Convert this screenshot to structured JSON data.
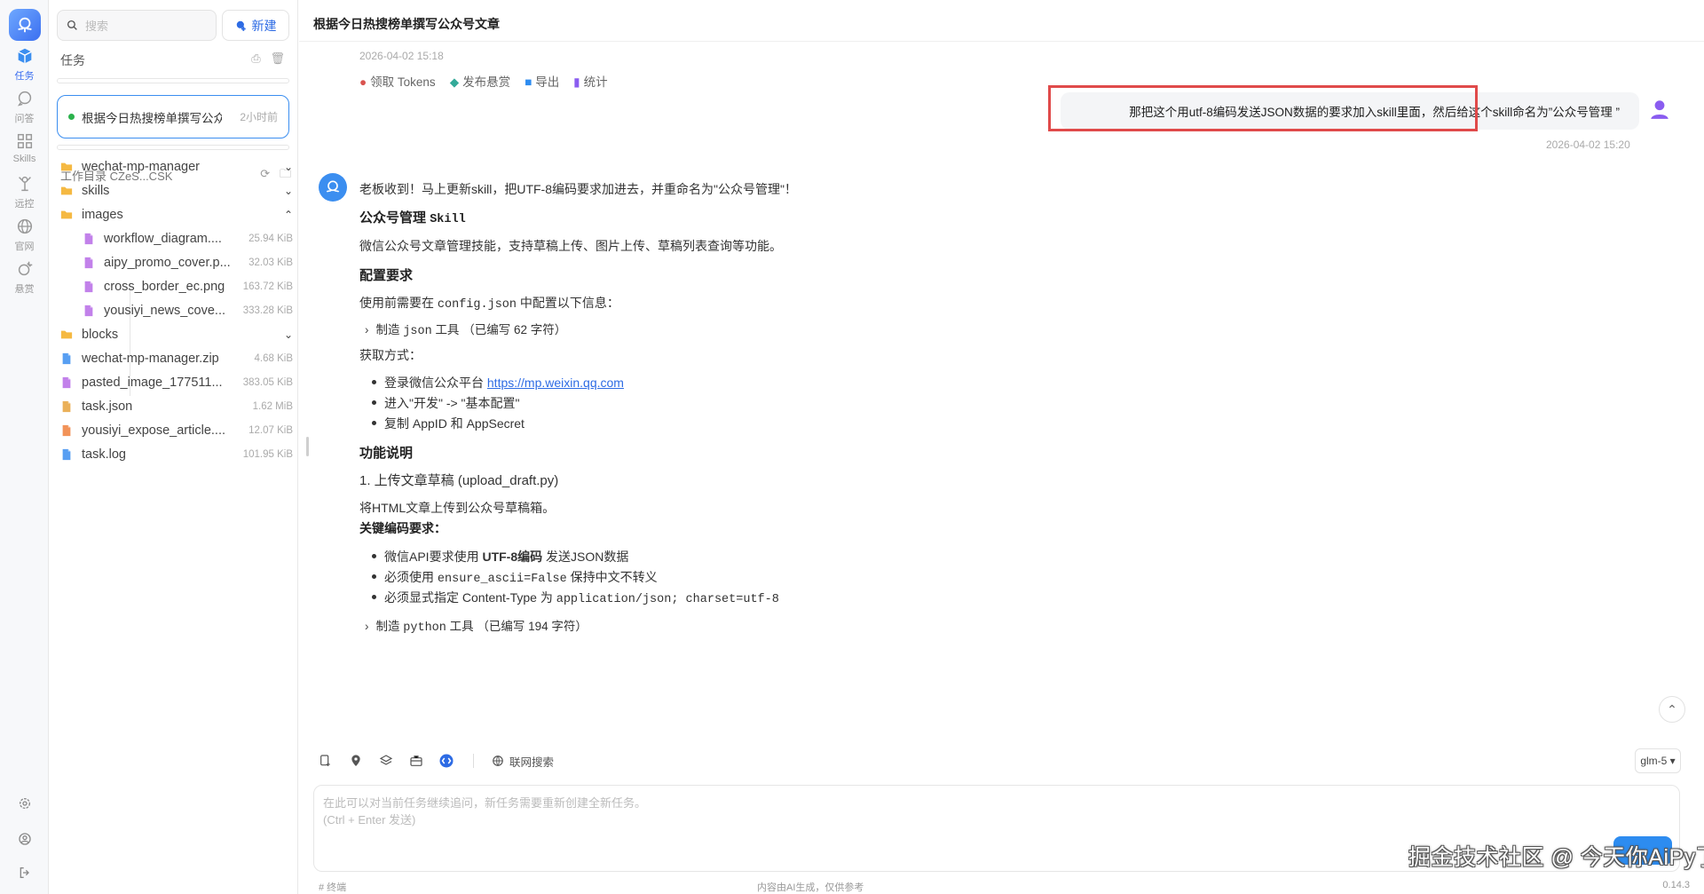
{
  "rail": {
    "items": [
      {
        "label": "任务",
        "icon": "cube-icon"
      },
      {
        "label": "问答",
        "icon": "chat-icon"
      },
      {
        "label": "Skills",
        "icon": "grid-icon"
      },
      {
        "label": "远控",
        "icon": "remote-icon"
      },
      {
        "label": "官网",
        "icon": "globe-icon"
      },
      {
        "label": "悬赏",
        "icon": "bounty-icon"
      }
    ]
  },
  "sidebar": {
    "search_placeholder": "搜索",
    "new_label": "新建",
    "tasks_title": "任务",
    "active_task": {
      "title": "根据今日热搜榜单撰写公众号文章",
      "time": "2小时前"
    },
    "workdir_label": "工作目录 CZeS...CSK",
    "tree": [
      {
        "name": "wechat-mp-manager",
        "type": "folder",
        "chevron": "⌄"
      },
      {
        "name": "skills",
        "type": "folder",
        "chevron": "⌄"
      },
      {
        "name": "images",
        "type": "folder",
        "chevron": "⌃"
      },
      {
        "name": "workflow_diagram....",
        "type": "png",
        "size": "25.94 KiB",
        "indent": true
      },
      {
        "name": "aipy_promo_cover.p...",
        "type": "png",
        "size": "32.03 KiB",
        "indent": true
      },
      {
        "name": "cross_border_ec.png",
        "type": "png",
        "size": "163.72 KiB",
        "indent": true
      },
      {
        "name": "yousiyi_news_cove...",
        "type": "png",
        "size": "333.28 KiB",
        "indent": true
      },
      {
        "name": "blocks",
        "type": "folder",
        "chevron": "⌄"
      },
      {
        "name": "wechat-mp-manager.zip",
        "type": "zip",
        "size": "4.68 KiB"
      },
      {
        "name": "pasted_image_177511...",
        "type": "png",
        "size": "383.05 KiB"
      },
      {
        "name": "task.json",
        "type": "json",
        "size": "1.62 MiB"
      },
      {
        "name": "yousiyi_expose_article....",
        "type": "html",
        "size": "12.07 KiB"
      },
      {
        "name": "task.log",
        "type": "log",
        "size": "101.95 KiB"
      }
    ]
  },
  "main": {
    "title": "根据今日热搜榜单撰写公众号文章",
    "prev_date": "2026-04-02 15:18",
    "prev_actions": [
      "领取 Tokens",
      "发布悬赏",
      "导出",
      "统计"
    ],
    "user_message": "那把这个用utf-8编码发送JSON数据的要求加入skill里面，然后给这个skill命名为”公众号管理 ”",
    "user_time": "2026-04-02 15:20",
    "reply": {
      "intro": "老板收到！马上更新skill，把UTF-8编码要求加进去，并重命名为\"公众号管理\"！",
      "h1_prefix": "公众号管理",
      "h1_code": "Skill",
      "desc": "微信公众号文章管理技能，支持草稿上传、图片上传、草稿列表查询等功能。",
      "h2": "配置要求",
      "config_prefix": "使用前需要在",
      "config_code": "config.json",
      "config_suffix": "中配置以下信息：",
      "tool1_prefix": "制造",
      "tool1_code": "json",
      "tool1_suffix": "工具  （已编写 62 字符）",
      "get_method": "获取方式：",
      "li1_prefix": "登录微信公众平台",
      "li1_link": "https://mp.weixin.qq.com",
      "li2": "进入\"开发\" -> \"基本配置\"",
      "li3": "复制 AppID 和 AppSecret",
      "h3": "功能说明",
      "func1": "1. 上传文章草稿 (upload_draft.py)",
      "func1_desc": "将HTML文章上传到公众号草稿箱。",
      "key_req": "关键编码要求：",
      "k1_prefix": "微信API要求使用",
      "k1_bold": "UTF-8编码",
      "k1_suffix": "发送JSON数据",
      "k2_prefix": "必须使用",
      "k2_code": "ensure_ascii=False",
      "k2_suffix": "保持中文不转义",
      "k3_prefix": "必须显式指定 Content-Type 为",
      "k3_code": "application/json; charset=utf-8",
      "tool2_prefix": "制造",
      "tool2_code": "python",
      "tool2_suffix": "工具  （已编写 194 字符）"
    },
    "composer": {
      "web_search_label": "联网搜索",
      "model": "glm-5 ▾",
      "placeholder_line1": "在此可以对当前任务继续追问，新任务需要重新创建全新任务。",
      "placeholder_line2": "(Ctrl + Enter 发送)"
    },
    "footer": {
      "left": "# 终端",
      "center": "内容由AI生成，仅供参考",
      "right": "0.14.3"
    },
    "watermark": "掘金技术社区 @ 今天你AiPy了吗"
  },
  "colors": {
    "accent": "#2d6be4",
    "highlight": "#e04a4a",
    "active_border": "#3b8ef0"
  }
}
